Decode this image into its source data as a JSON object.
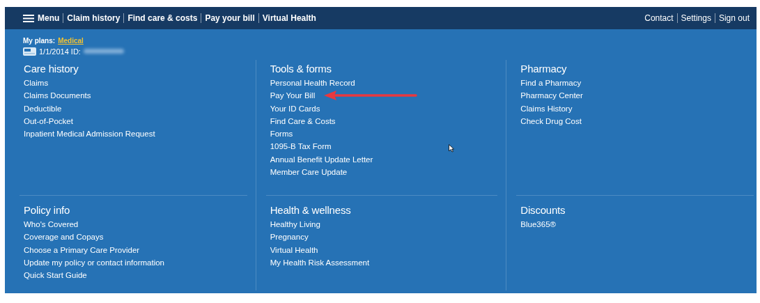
{
  "nav": {
    "menu": "Menu",
    "links": [
      "Claim history",
      "Find care & costs",
      "Pay your bill",
      "Virtual Health"
    ],
    "right_links": [
      "Contact",
      "Settings",
      "Sign out"
    ]
  },
  "plan": {
    "label": "My plans:",
    "plan_link": "Medical",
    "card_line": "1/1/2014 ID:"
  },
  "section_rows": [
    {
      "sections": [
        {
          "title": "Care history",
          "links": [
            "Claims",
            "Claims Documents",
            "Deductible",
            "Out-of-Pocket",
            "Inpatient Medical Admission Request"
          ]
        },
        {
          "title": "Tools & forms",
          "links": [
            "Personal Health Record",
            "Pay Your Bill",
            "Your ID Cards",
            "Find Care & Costs",
            "Forms",
            "1095-B Tax Form",
            "Annual Benefit Update Letter",
            "Member Care Update"
          ]
        },
        {
          "title": "Pharmacy",
          "links": [
            "Find a Pharmacy",
            "Pharmacy Center",
            "Claims History",
            "Check Drug Cost"
          ]
        }
      ]
    },
    {
      "sections": [
        {
          "title": "Policy info",
          "links": [
            "Who's Covered",
            "Coverage and Copays",
            "Choose a Primary Care Provider",
            "Update my policy or contact information",
            "Quick Start Guide"
          ]
        },
        {
          "title": "Health & wellness",
          "links": [
            "Healthy Living",
            "Pregnancy",
            "Virtual Health",
            "My Health Risk Assessment"
          ]
        },
        {
          "title": "Discounts",
          "links": [
            "Blue365®"
          ]
        }
      ]
    }
  ]
}
